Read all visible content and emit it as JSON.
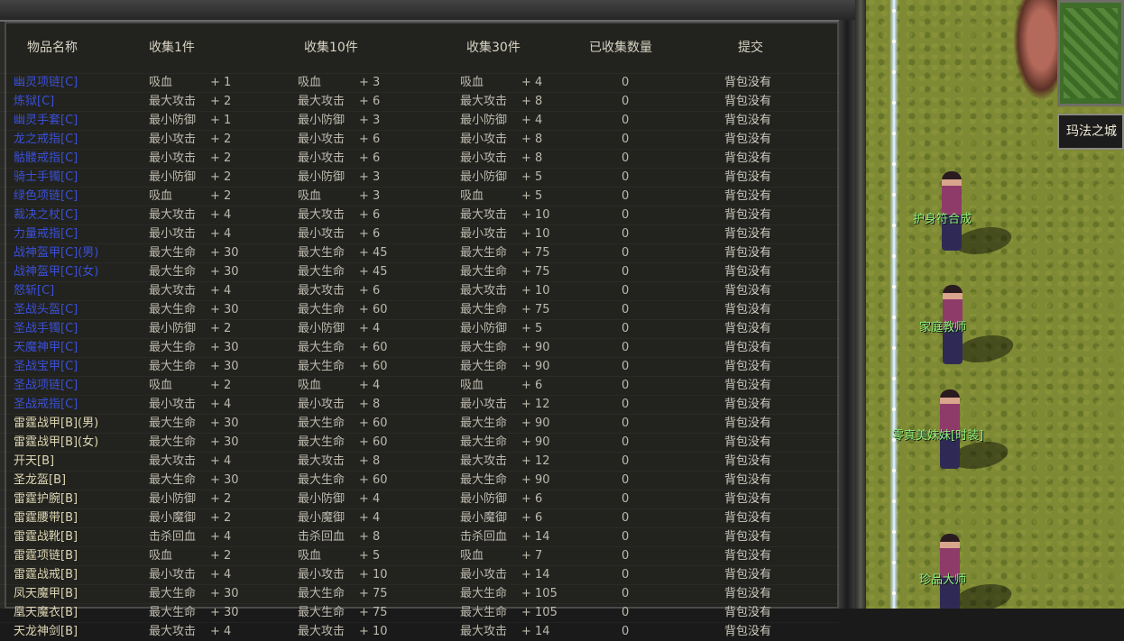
{
  "panel": {
    "headers": {
      "name": "物品名称",
      "collect1": "收集1件",
      "collect10": "收集10件",
      "collect30": "收集30件",
      "count": "已收集数量",
      "submit": "提交"
    },
    "rows": [
      {
        "name": "幽灵项链[C]",
        "tier": "C",
        "a1": "吸血",
        "v1": "+ 1",
        "a2": "吸血",
        "v2": "+ 3",
        "a3": "吸血",
        "v3": "+ 4",
        "count": "0",
        "submit": "背包没有"
      },
      {
        "name": "炼狱[C]",
        "tier": "C",
        "a1": "最大攻击",
        "v1": "+ 2",
        "a2": "最大攻击",
        "v2": "+ 6",
        "a3": "最大攻击",
        "v3": "+ 8",
        "count": "0",
        "submit": "背包没有"
      },
      {
        "name": "幽灵手套[C]",
        "tier": "C",
        "a1": "最小防御",
        "v1": "+ 1",
        "a2": "最小防御",
        "v2": "+ 3",
        "a3": "最小防御",
        "v3": "+ 4",
        "count": "0",
        "submit": "背包没有"
      },
      {
        "name": "龙之戒指[C]",
        "tier": "C",
        "a1": "最小攻击",
        "v1": "+ 2",
        "a2": "最小攻击",
        "v2": "+ 6",
        "a3": "最小攻击",
        "v3": "+ 8",
        "count": "0",
        "submit": "背包没有"
      },
      {
        "name": "骷髅戒指[C]",
        "tier": "C",
        "a1": "最小攻击",
        "v1": "+ 2",
        "a2": "最小攻击",
        "v2": "+ 6",
        "a3": "最小攻击",
        "v3": "+ 8",
        "count": "0",
        "submit": "背包没有"
      },
      {
        "name": "骑士手镯[C]",
        "tier": "C",
        "a1": "最小防御",
        "v1": "+ 2",
        "a2": "最小防御",
        "v2": "+ 3",
        "a3": "最小防御",
        "v3": "+ 5",
        "count": "0",
        "submit": "背包没有"
      },
      {
        "name": "绿色项链[C]",
        "tier": "C",
        "a1": "吸血",
        "v1": "+ 2",
        "a2": "吸血",
        "v2": "+ 3",
        "a3": "吸血",
        "v3": "+ 5",
        "count": "0",
        "submit": "背包没有"
      },
      {
        "name": "裁决之杖[C]",
        "tier": "C",
        "a1": "最大攻击",
        "v1": "+ 4",
        "a2": "最大攻击",
        "v2": "+ 6",
        "a3": "最大攻击",
        "v3": "+ 10",
        "count": "0",
        "submit": "背包没有"
      },
      {
        "name": "力量戒指[C]",
        "tier": "C",
        "a1": "最小攻击",
        "v1": "+ 4",
        "a2": "最小攻击",
        "v2": "+ 6",
        "a3": "最小攻击",
        "v3": "+ 10",
        "count": "0",
        "submit": "背包没有"
      },
      {
        "name": "战神盔甲[C](男)",
        "tier": "C",
        "a1": "最大生命",
        "v1": "+ 30",
        "a2": "最大生命",
        "v2": "+ 45",
        "a3": "最大生命",
        "v3": "+ 75",
        "count": "0",
        "submit": "背包没有"
      },
      {
        "name": "战神盔甲[C](女)",
        "tier": "C",
        "a1": "最大生命",
        "v1": "+ 30",
        "a2": "最大生命",
        "v2": "+ 45",
        "a3": "最大生命",
        "v3": "+ 75",
        "count": "0",
        "submit": "背包没有"
      },
      {
        "name": "怒斩[C]",
        "tier": "C",
        "a1": "最大攻击",
        "v1": "+ 4",
        "a2": "最大攻击",
        "v2": "+ 6",
        "a3": "最大攻击",
        "v3": "+ 10",
        "count": "0",
        "submit": "背包没有"
      },
      {
        "name": "圣战头盔[C]",
        "tier": "C",
        "a1": "最大生命",
        "v1": "+ 30",
        "a2": "最大生命",
        "v2": "+ 60",
        "a3": "最大生命",
        "v3": "+ 75",
        "count": "0",
        "submit": "背包没有"
      },
      {
        "name": "圣战手镯[C]",
        "tier": "C",
        "a1": "最小防御",
        "v1": "+ 2",
        "a2": "最小防御",
        "v2": "+ 4",
        "a3": "最小防御",
        "v3": "+ 5",
        "count": "0",
        "submit": "背包没有"
      },
      {
        "name": "天魔神甲[C]",
        "tier": "C",
        "a1": "最大生命",
        "v1": "+ 30",
        "a2": "最大生命",
        "v2": "+ 60",
        "a3": "最大生命",
        "v3": "+ 90",
        "count": "0",
        "submit": "背包没有"
      },
      {
        "name": "圣战宝甲[C]",
        "tier": "C",
        "a1": "最大生命",
        "v1": "+ 30",
        "a2": "最大生命",
        "v2": "+ 60",
        "a3": "最大生命",
        "v3": "+ 90",
        "count": "0",
        "submit": "背包没有"
      },
      {
        "name": "圣战项链[C]",
        "tier": "C",
        "a1": "吸血",
        "v1": "+ 2",
        "a2": "吸血",
        "v2": "+ 4",
        "a3": "吸血",
        "v3": "+ 6",
        "count": "0",
        "submit": "背包没有"
      },
      {
        "name": "圣战戒指[C]",
        "tier": "C",
        "a1": "最小攻击",
        "v1": "+ 4",
        "a2": "最小攻击",
        "v2": "+ 8",
        "a3": "最小攻击",
        "v3": "+ 12",
        "count": "0",
        "submit": "背包没有"
      },
      {
        "name": "雷霆战甲[B](男)",
        "tier": "B",
        "a1": "最大生命",
        "v1": "+ 30",
        "a2": "最大生命",
        "v2": "+ 60",
        "a3": "最大生命",
        "v3": "+ 90",
        "count": "0",
        "submit": "背包没有"
      },
      {
        "name": "雷霆战甲[B](女)",
        "tier": "B",
        "a1": "最大生命",
        "v1": "+ 30",
        "a2": "最大生命",
        "v2": "+ 60",
        "a3": "最大生命",
        "v3": "+ 90",
        "count": "0",
        "submit": "背包没有"
      },
      {
        "name": "开天[B]",
        "tier": "B",
        "a1": "最大攻击",
        "v1": "+ 4",
        "a2": "最大攻击",
        "v2": "+ 8",
        "a3": "最大攻击",
        "v3": "+ 12",
        "count": "0",
        "submit": "背包没有"
      },
      {
        "name": "圣龙盔[B]",
        "tier": "B",
        "a1": "最大生命",
        "v1": "+ 30",
        "a2": "最大生命",
        "v2": "+ 60",
        "a3": "最大生命",
        "v3": "+ 90",
        "count": "0",
        "submit": "背包没有"
      },
      {
        "name": "雷霆护腕[B]",
        "tier": "B",
        "a1": "最小防御",
        "v1": "+ 2",
        "a2": "最小防御",
        "v2": "+ 4",
        "a3": "最小防御",
        "v3": "+ 6",
        "count": "0",
        "submit": "背包没有"
      },
      {
        "name": "雷霆腰带[B]",
        "tier": "B",
        "a1": "最小魔御",
        "v1": "+ 2",
        "a2": "最小魔御",
        "v2": "+ 4",
        "a3": "最小魔御",
        "v3": "+ 6",
        "count": "0",
        "submit": "背包没有"
      },
      {
        "name": "雷霆战靴[B]",
        "tier": "B",
        "a1": "击杀回血",
        "v1": "+ 4",
        "a2": "击杀回血",
        "v2": "+ 8",
        "a3": "击杀回血",
        "v3": "+ 14",
        "count": "0",
        "submit": "背包没有"
      },
      {
        "name": "雷霆项链[B]",
        "tier": "B",
        "a1": "吸血",
        "v1": "+ 2",
        "a2": "吸血",
        "v2": "+ 5",
        "a3": "吸血",
        "v3": "+ 7",
        "count": "0",
        "submit": "背包没有"
      },
      {
        "name": "雷霆战戒[B]",
        "tier": "B",
        "a1": "最小攻击",
        "v1": "+ 4",
        "a2": "最小攻击",
        "v2": "+ 10",
        "a3": "最小攻击",
        "v3": "+ 14",
        "count": "0",
        "submit": "背包没有"
      },
      {
        "name": "凤天魔甲[B]",
        "tier": "B",
        "a1": "最大生命",
        "v1": "+ 30",
        "a2": "最大生命",
        "v2": "+ 75",
        "a3": "最大生命",
        "v3": "+ 105",
        "count": "0",
        "submit": "背包没有"
      },
      {
        "name": "凰天魔衣[B]",
        "tier": "B",
        "a1": "最大生命",
        "v1": "+ 30",
        "a2": "最大生命",
        "v2": "+ 75",
        "a3": "最大生命",
        "v3": "+ 105",
        "count": "0",
        "submit": "背包没有"
      },
      {
        "name": "天龙神剑[B]",
        "tier": "B",
        "a1": "最大攻击",
        "v1": "+ 4",
        "a2": "最大攻击",
        "v2": "+ 10",
        "a3": "最大攻击",
        "v3": "+ 14",
        "count": "0",
        "submit": "背包没有"
      }
    ]
  },
  "scene": {
    "city_name": "玛法之城",
    "npcs": [
      {
        "name": "护身符合成"
      },
      {
        "name": "家庭教师"
      },
      {
        "name": "零真美妹妹[时装]"
      },
      {
        "name": "珍品大师"
      }
    ]
  },
  "colors": {
    "tier_c": "#3a4fd6",
    "tier_b": "#ddd6b2",
    "npc_name": "#8df07a"
  }
}
